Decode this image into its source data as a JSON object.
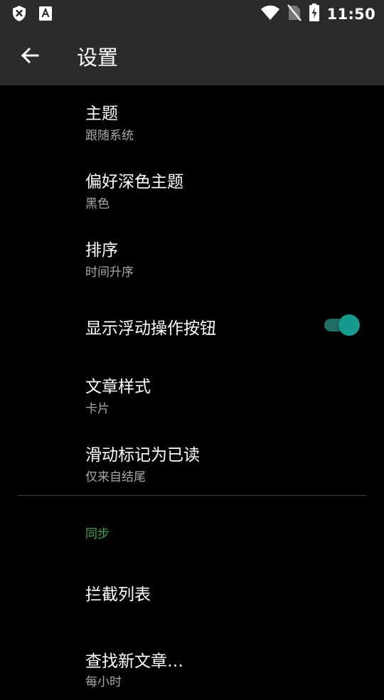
{
  "status_bar": {
    "time": "11:50"
  },
  "app_bar": {
    "title": "设置"
  },
  "settings": [
    {
      "title": "主题",
      "subtitle": "跟随系统"
    },
    {
      "title": "偏好深色主题",
      "subtitle": "黑色"
    },
    {
      "title": "排序",
      "subtitle": "时间升序"
    },
    {
      "title": "显示浮动操作按钮",
      "toggle_on": true
    },
    {
      "title": "文章样式",
      "subtitle": "卡片"
    },
    {
      "title": "滑动标记为已读",
      "subtitle": "仅来自结尾"
    }
  ],
  "sync_section": {
    "header": "同步",
    "items": [
      {
        "title": "拦截列表"
      },
      {
        "title": "查找新文章…",
        "subtitle": "每小时"
      }
    ]
  },
  "colors": {
    "accent": "#3fa45a",
    "switch_thumb": "#159b8e",
    "bar_bg": "#2b2b2b"
  }
}
